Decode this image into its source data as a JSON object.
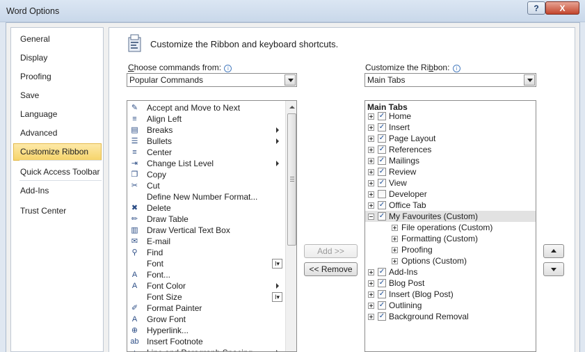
{
  "window": {
    "title": "Word Options",
    "help_label": "?",
    "close_label": "X"
  },
  "nav": {
    "items": [
      {
        "label": "General"
      },
      {
        "label": "Display"
      },
      {
        "label": "Proofing"
      },
      {
        "label": "Save"
      },
      {
        "label": "Language"
      },
      {
        "label": "Advanced"
      },
      {
        "label": "Customize Ribbon",
        "active": true
      },
      {
        "label": "Quick Access Toolbar"
      },
      {
        "label": "Add-Ins"
      },
      {
        "label": "Trust Center"
      }
    ]
  },
  "header": {
    "title": "Customize the Ribbon and keyboard shortcuts."
  },
  "commands_from": {
    "label_pre": "",
    "label_accel": "C",
    "label_post": "hoose commands from:",
    "value": "Popular Commands"
  },
  "customize_ribbon": {
    "label_pre": "Customize the Ri",
    "label_accel": "b",
    "label_post": "bon:",
    "value": "Main Tabs"
  },
  "commands": [
    {
      "label": "Accept and Move to Next",
      "icon": "accept-change-icon",
      "glyph": "✎"
    },
    {
      "label": "Align Left",
      "icon": "align-left-icon",
      "glyph": "≡"
    },
    {
      "label": "Breaks",
      "icon": "page-breaks-icon",
      "glyph": "▤",
      "submenu": true
    },
    {
      "label": "Bullets",
      "icon": "bullets-icon",
      "glyph": "☰",
      "submenu": true
    },
    {
      "label": "Center",
      "icon": "align-center-icon",
      "glyph": "≡"
    },
    {
      "label": "Change List Level",
      "icon": "list-level-icon",
      "glyph": "⇥",
      "submenu": true
    },
    {
      "label": "Copy",
      "icon": "copy-icon",
      "glyph": "❐"
    },
    {
      "label": "Cut",
      "icon": "scissors-icon",
      "glyph": "✂"
    },
    {
      "label": "Define New Number Format...",
      "icon": "",
      "glyph": ""
    },
    {
      "label": "Delete",
      "icon": "delete-icon",
      "glyph": "✖"
    },
    {
      "label": "Draw Table",
      "icon": "draw-table-icon",
      "glyph": "✏"
    },
    {
      "label": "Draw Vertical Text Box",
      "icon": "text-box-icon",
      "glyph": "▥"
    },
    {
      "label": "E-mail",
      "icon": "email-icon",
      "glyph": "✉"
    },
    {
      "label": "Find",
      "icon": "binoculars-icon",
      "glyph": "⚲"
    },
    {
      "label": "Font",
      "icon": "",
      "glyph": "",
      "selector": true
    },
    {
      "label": "Font...",
      "icon": "font-a-icon",
      "glyph": "A"
    },
    {
      "label": "Font Color",
      "icon": "font-color-icon",
      "glyph": "A",
      "submenu": true
    },
    {
      "label": "Font Size",
      "icon": "",
      "glyph": "",
      "selector": true
    },
    {
      "label": "Format Painter",
      "icon": "paintbrush-icon",
      "glyph": "✐"
    },
    {
      "label": "Grow Font",
      "icon": "grow-font-icon",
      "glyph": "A"
    },
    {
      "label": "Hyperlink...",
      "icon": "hyperlink-icon",
      "glyph": "⊕"
    },
    {
      "label": "Insert Footnote",
      "icon": "footnote-icon",
      "glyph": "ab"
    },
    {
      "label": "Line and Paragraph Spacing",
      "icon": "line-spacing-icon",
      "glyph": "↕",
      "submenu": true
    }
  ],
  "selector_glyph": "I▾",
  "buttons": {
    "add": "Add >>",
    "remove": "<< Remove"
  },
  "tabs_tree": {
    "header": "Main Tabs",
    "items": [
      {
        "label": "Home",
        "checked": true,
        "level": 0,
        "expanded": false
      },
      {
        "label": "Insert",
        "checked": true,
        "level": 0,
        "expanded": false
      },
      {
        "label": "Page Layout",
        "checked": true,
        "level": 0,
        "expanded": false
      },
      {
        "label": "References",
        "checked": true,
        "level": 0,
        "expanded": false
      },
      {
        "label": "Mailings",
        "checked": true,
        "level": 0,
        "expanded": false
      },
      {
        "label": "Review",
        "checked": true,
        "level": 0,
        "expanded": false
      },
      {
        "label": "View",
        "checked": true,
        "level": 0,
        "expanded": false
      },
      {
        "label": "Developer",
        "checked": false,
        "level": 0,
        "expanded": false
      },
      {
        "label": "Office Tab",
        "checked": true,
        "level": 0,
        "expanded": false
      },
      {
        "label": "My Favourites (Custom)",
        "checked": true,
        "level": 0,
        "expanded": true,
        "selected": true
      },
      {
        "label": "File operations (Custom)",
        "level": 1,
        "expanded": false
      },
      {
        "label": "Formatting (Custom)",
        "level": 1,
        "expanded": false
      },
      {
        "label": "Proofing",
        "level": 1,
        "expanded": false
      },
      {
        "label": "Options (Custom)",
        "level": 1,
        "expanded": false
      },
      {
        "label": "Add-Ins",
        "checked": true,
        "level": 0,
        "expanded": false
      },
      {
        "label": "Blog Post",
        "checked": true,
        "level": 0,
        "expanded": false
      },
      {
        "label": "Insert (Blog Post)",
        "checked": true,
        "level": 0,
        "expanded": false
      },
      {
        "label": "Outlining",
        "checked": true,
        "level": 0,
        "expanded": false
      },
      {
        "label": "Background Removal",
        "checked": true,
        "level": 0,
        "expanded": false
      }
    ]
  },
  "check_glyph": "✓"
}
